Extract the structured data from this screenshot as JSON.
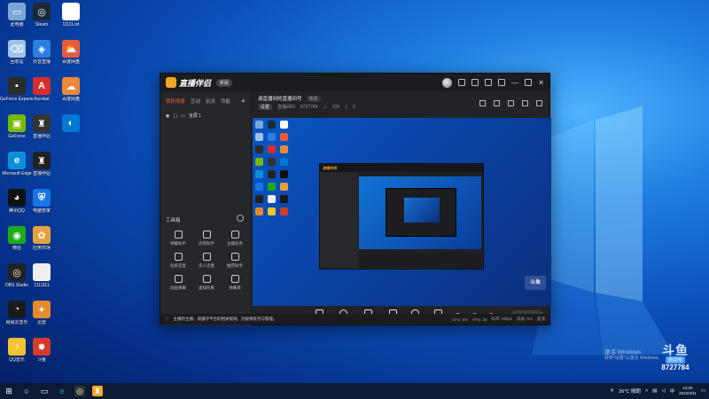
{
  "desktop": {
    "icons": [
      {
        "label": "此电脑",
        "color": "#7aa7d6",
        "glyph": "▭"
      },
      {
        "label": "Steam",
        "color": "#1b2838",
        "glyph": "◎"
      },
      {
        "label": "11111.txt",
        "color": "#ffffff",
        "glyph": ""
      },
      {
        "label": "回收站",
        "color": "#9fc3e6",
        "glyph": "⌫"
      },
      {
        "label": "抖音直播",
        "color": "#2a7fe0",
        "glyph": "◈"
      },
      {
        "label": "百度网盘",
        "color": "#e85a3c",
        "glyph": "⛅"
      },
      {
        "label": "GeForce Experience",
        "color": "#2b2b2b",
        "glyph": "▪"
      },
      {
        "label": "Acrobat",
        "color": "#d62e2e",
        "glyph": "A"
      },
      {
        "label": "百度网盘",
        "color": "#e8893c",
        "glyph": "☁"
      },
      {
        "label": "GeForce",
        "color": "#76b900",
        "glyph": "▣"
      },
      {
        "label": "直播伴侣",
        "color": "#333",
        "glyph": "♜"
      },
      {
        "label": "",
        "color": "#0078d4",
        "glyph": "◐"
      },
      {
        "label": "Microsoft Edge",
        "color": "#0a8fd8",
        "glyph": "e"
      },
      {
        "label": "直播伴侣",
        "color": "#222",
        "glyph": "♜"
      },
      {
        "label": "",
        "color": "#0",
        "glyph": ""
      },
      {
        "label": "腾讯QQ",
        "color": "#111",
        "glyph": "◕"
      },
      {
        "label": "电脑管家",
        "color": "#1a73e8",
        "glyph": "⛨"
      },
      {
        "label": "",
        "color": "#0",
        "glyph": ""
      },
      {
        "label": "微信",
        "color": "#1aad19",
        "glyph": "◉"
      },
      {
        "label": "应用市场",
        "color": "#e8a03c",
        "glyph": "✿"
      },
      {
        "label": "",
        "color": "#0",
        "glyph": ""
      },
      {
        "label": "OBS Studio",
        "color": "#222",
        "glyph": "◎"
      },
      {
        "label": "1111111",
        "color": "#eeeeee",
        "glyph": ""
      },
      {
        "label": "",
        "color": "#0",
        "glyph": ""
      },
      {
        "label": "网易云音乐",
        "color": "#1a1a1a",
        "glyph": "◔"
      },
      {
        "label": "迅雷",
        "color": "#e8892c",
        "glyph": "✦"
      },
      {
        "label": "",
        "color": "#0",
        "glyph": ""
      },
      {
        "label": "QQ音乐",
        "color": "#f2c230",
        "glyph": "♪"
      },
      {
        "label": "斗鱼",
        "color": "#d63a2a",
        "glyph": "✸"
      }
    ]
  },
  "app": {
    "title": "直播伴侣",
    "version": "新版",
    "side_tabs": [
      "我的场景",
      "互动",
      "玩法",
      "功能"
    ],
    "scene_label": "全屏 1",
    "tools_title": "工具箱",
    "tools": [
      "弹幕助手",
      "房管助手",
      "主播任务",
      "投屏连麦",
      "多人连麦",
      "推荐助手",
      "动画弹幕",
      "虚拟形象",
      "弹幕库"
    ],
    "room_title": "请直播间的直播间号",
    "room_tag": "修改",
    "room_setting": "设置",
    "room_id_label": "直播间ID",
    "room_id": "8727784",
    "fans": "225",
    "likes": "0",
    "inner_title": "直播伴侣",
    "preview_badge": "斗鱼",
    "bottom_tools": [
      "直播屏幕",
      "摄像头",
      "手机投屏",
      "多媒体",
      "麦克风",
      "扬声器"
    ],
    "start_button": "开始直播",
    "status": {
      "warning": "主播新主播，请遵守平台的相关规则。违规将处罚与管理。",
      "cpu": "CPU: 6%",
      "fps": "FPS: 30",
      "bitrate": "码率: 0kbps",
      "drop": "丢帧: 0%",
      "quality": "超清"
    }
  },
  "watermark": {
    "line1": "激活 Windows",
    "line2": "转到\"设置\"以激活 Windows。"
  },
  "douyu_badge": {
    "logo": "斗鱼",
    "sub": "房间号",
    "room": "8727784"
  },
  "taskbar": {
    "weather": "26°C 晴朗",
    "time": "13:25",
    "date": "2022/3/11",
    "lang": "中"
  }
}
